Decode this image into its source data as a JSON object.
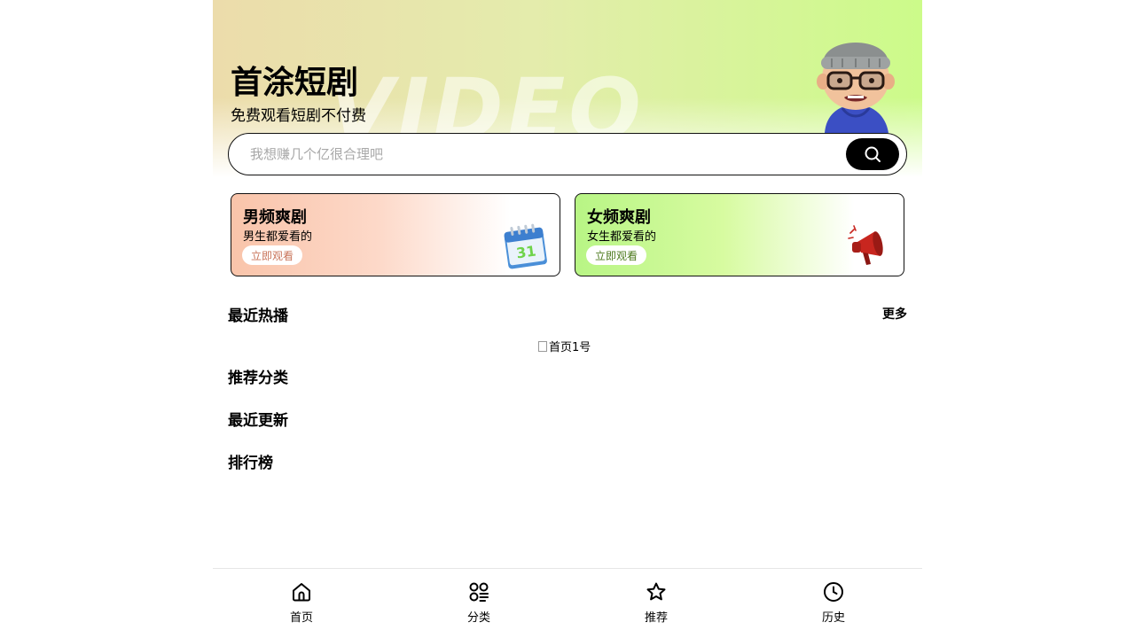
{
  "header": {
    "watermark": "VIDEO",
    "title": "首涂短剧",
    "subtitle": "免费观看短剧不付费"
  },
  "search": {
    "placeholder": "我想赚几个亿很合理吧",
    "value": "",
    "button_icon": "search-icon"
  },
  "cards": [
    {
      "title": "男频爽剧",
      "subtitle": "男生都爱看的",
      "button": "立即观看",
      "icon": "calendar-icon"
    },
    {
      "title": "女频爽剧",
      "subtitle": "女生都爱看的",
      "button": "立即观看",
      "icon": "megaphone-icon"
    }
  ],
  "sections": {
    "recent_hot": "最近热播",
    "more": "更多",
    "broken_image_alt": "首页1号",
    "recommended": "推荐分类",
    "recent_update": "最近更新",
    "ranking": "排行榜"
  },
  "tabbar": [
    {
      "label": "首页",
      "icon": "home-icon"
    },
    {
      "label": "分类",
      "icon": "category-icon"
    },
    {
      "label": "推荐",
      "icon": "star-icon"
    },
    {
      "label": "历史",
      "icon": "clock-icon"
    }
  ],
  "colors": {
    "hero_left": "#ecdcab",
    "hero_right": "#ccfb8a",
    "male_card": "#f9c4aa",
    "female_card": "#b8f585",
    "search_button": "#000000"
  }
}
